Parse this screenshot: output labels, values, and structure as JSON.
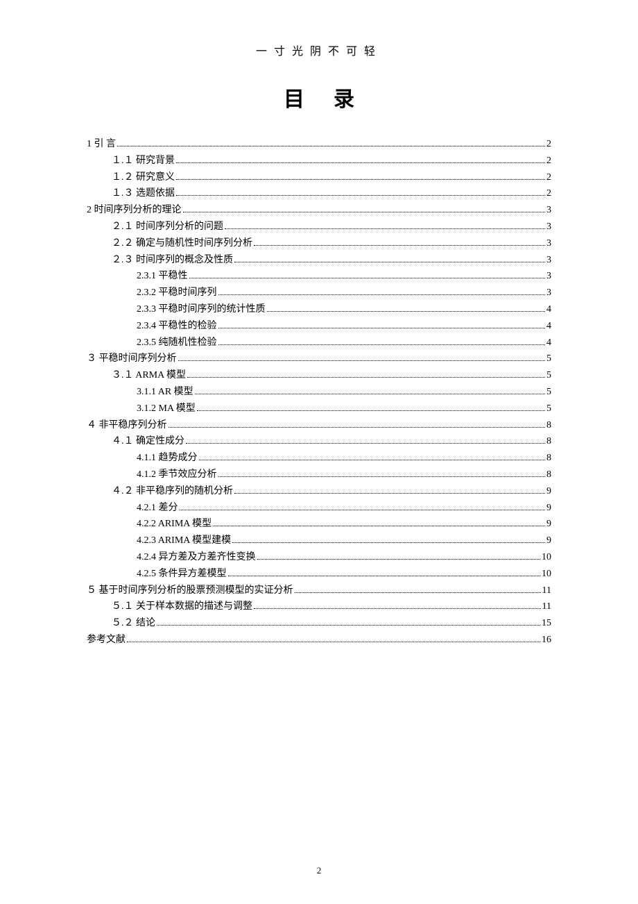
{
  "header": {
    "saying": "一寸光阴不可轻",
    "title": "目录"
  },
  "footer": {
    "page_number": "2"
  },
  "toc": [
    {
      "indent": 0,
      "label": "1 引  言",
      "page": "2"
    },
    {
      "indent": 1,
      "label": "１.１ 研究背景",
      "page": "2"
    },
    {
      "indent": 1,
      "label": "１.２ 研究意义",
      "page": "2"
    },
    {
      "indent": 1,
      "label": "１.３ 选题依据",
      "page": "2"
    },
    {
      "indent": 0,
      "label": "2 时间序列分析的理论",
      "page": "3"
    },
    {
      "indent": 1,
      "label": "２.１  时间序列分析的问题",
      "page": "3"
    },
    {
      "indent": 1,
      "label": "２.２  确定与随机性时间序列分析",
      "page": "3"
    },
    {
      "indent": 1,
      "label": "２.３  时间序列的概念及性质",
      "page": "3"
    },
    {
      "indent": 2,
      "label": "2.3.1  平稳性",
      "page": "3"
    },
    {
      "indent": 2,
      "label": "2.3.2  平稳时间序列",
      "page": "3"
    },
    {
      "indent": 2,
      "label": "2.3.3  平稳时间序列的统计性质",
      "page": "4"
    },
    {
      "indent": 2,
      "label": "2.3.4 平稳性的检验",
      "page": "4"
    },
    {
      "indent": 2,
      "label": "2.3.5 纯随机性检验",
      "page": "4"
    },
    {
      "indent": 0,
      "label": "３ 平稳时间序列分析",
      "page": "5"
    },
    {
      "indent": 1,
      "label": "３.１ ARMA 模型",
      "page": "5"
    },
    {
      "indent": 2,
      "label": "3.1.1 AR 模型",
      "page": "5"
    },
    {
      "indent": 2,
      "label": "3.1.2 MA 模型",
      "page": "5"
    },
    {
      "indent": 0,
      "label": "４ 非平稳序列分析",
      "page": "8"
    },
    {
      "indent": 1,
      "label": "４.１  确定性成分",
      "page": "8"
    },
    {
      "indent": 2,
      "label": "4.1.1  趋势成分",
      "page": "8"
    },
    {
      "indent": 2,
      "label": "4.1.2  季节效应分析",
      "page": "8"
    },
    {
      "indent": 1,
      "label": "４.２ 非平稳序列的随机分析",
      "page": "9"
    },
    {
      "indent": 2,
      "label": "4.2.1  差分",
      "page": "9"
    },
    {
      "indent": 2,
      "label": "4.2.2  ARIMA 模型",
      "page": "9"
    },
    {
      "indent": 2,
      "label": "4.2.3 ARIMA 模型建模",
      "page": "9"
    },
    {
      "indent": 2,
      "label": "4.2.4  异方差及方差齐性变换",
      "page": "10"
    },
    {
      "indent": 2,
      "label": "4.2.5 条件异方差模型",
      "page": "10"
    },
    {
      "indent": 0,
      "label": "５  基于时间序列分析的股票预测模型的实证分析",
      "page": "11"
    },
    {
      "indent": 1,
      "label": "５.１ 关于样本数据的描述与调整",
      "page": "11"
    },
    {
      "indent": 1,
      "label": "５.２ 结论",
      "page": "15"
    },
    {
      "indent": 0,
      "label": "参考文献",
      "page": "16"
    }
  ]
}
